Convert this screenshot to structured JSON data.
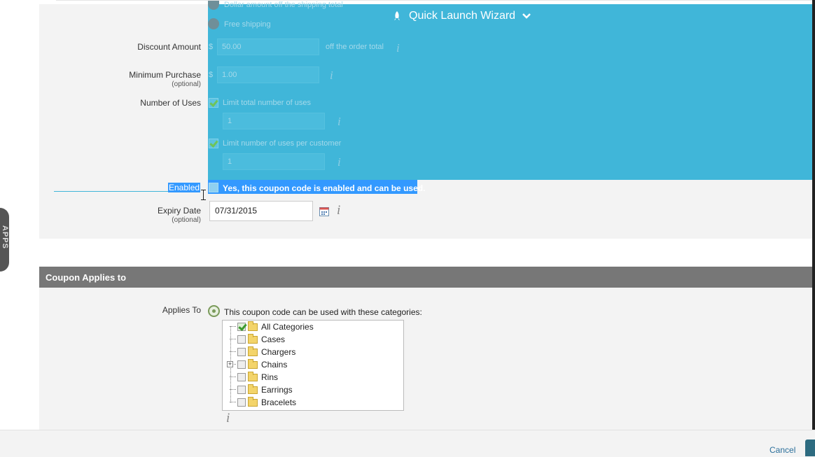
{
  "form": {
    "overlay_option_dollar": "Dollar amount off the shipping total",
    "overlay_option_free": "Free shipping",
    "discount_label": "Discount Amount",
    "discount_currency": "$",
    "discount_value": "50.00",
    "discount_suffix": "off the order total",
    "min_purchase_label": "Minimum Purchase",
    "min_purchase_optional": "(optional)",
    "min_purchase_currency": "$",
    "min_purchase_value": "1.00",
    "uses_label": "Number of Uses",
    "limit_total_label": "Limit total number of uses",
    "limit_total_value": "1",
    "limit_customer_label": "Limit number of uses per customer",
    "limit_customer_value": "1",
    "enabled_label": "Enabled",
    "enabled_text": "Yes, this coupon code is enabled and can be used.",
    "expiry_label": "Expiry Date",
    "expiry_optional": "(optional)",
    "expiry_value": "07/31/2015",
    "info_glyph": "i"
  },
  "wizard": {
    "label": "Quick Launch Wizard"
  },
  "side_tab": {
    "label": "APPS"
  },
  "applies": {
    "section_title": "Coupon Applies to",
    "label": "Applies To",
    "option_text": "This coupon code can be used with these categories:",
    "categories": [
      {
        "label": "All Categories",
        "checked": true
      },
      {
        "label": "Cases",
        "checked": false
      },
      {
        "label": "Chargers",
        "checked": false
      },
      {
        "label": "Chains",
        "checked": false,
        "expandable": true
      },
      {
        "label": "Rins",
        "checked": false
      },
      {
        "label": "Earrings",
        "checked": false
      },
      {
        "label": "Bracelets",
        "checked": false
      }
    ]
  },
  "footer": {
    "cancel_label": "Cancel"
  },
  "colors": {
    "overlay": "#40b6d9",
    "section_header": "#777777",
    "link": "#2a6f9b"
  }
}
